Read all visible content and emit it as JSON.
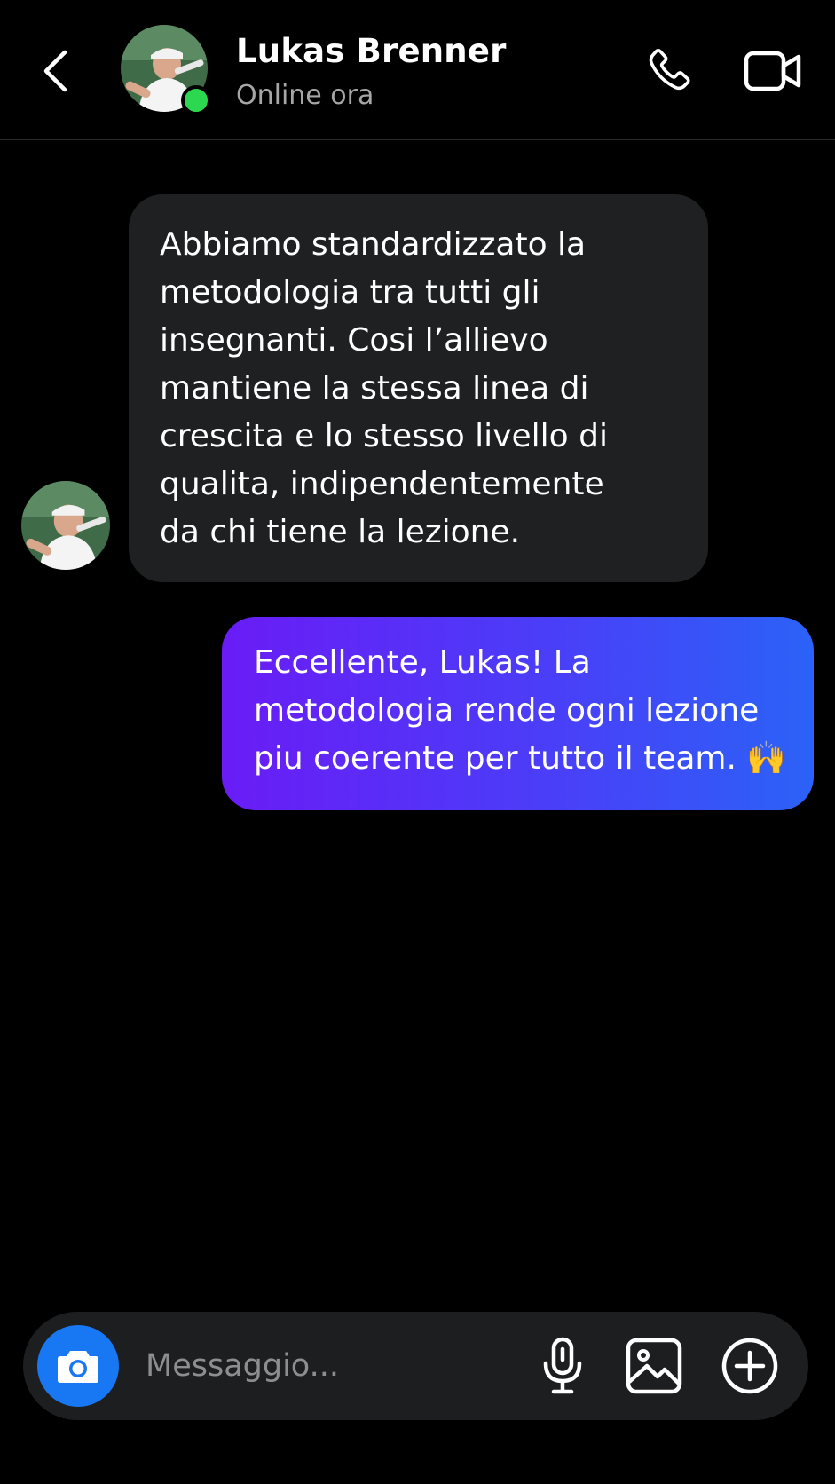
{
  "header": {
    "contact_name": "Lukas Brenner",
    "status": "Online ora",
    "status_color": "#2bd84f"
  },
  "icons": {
    "back": "chevron-left-icon",
    "call": "phone-icon",
    "video": "video-camera-icon",
    "camera": "camera-icon",
    "mic": "microphone-icon",
    "gallery": "image-icon",
    "plus": "plus-circle-icon"
  },
  "messages": [
    {
      "direction": "incoming",
      "text": "Abbiamo standardizzato la\nmetodologia tra tutti gli\ninsegnanti. Cosi l’allievo\nmantiene la stessa linea di\ncrescita e lo stesso livello di\nqualita, indipendentemente\nda chi tiene la lezione."
    },
    {
      "direction": "outgoing",
      "text": "Eccellente, Lukas! La\nmetodologia rende ogni lezione\npiu coerente per tutto il team. 🙌"
    }
  ],
  "composer": {
    "placeholder": "Messaggio...",
    "value": ""
  },
  "colors": {
    "background": "#000000",
    "incoming_bubble": "#1f2021",
    "outgoing_gradient_start": "#6a1cf6",
    "outgoing_gradient_end": "#2b62f7",
    "camera_button": "#1877f2"
  }
}
